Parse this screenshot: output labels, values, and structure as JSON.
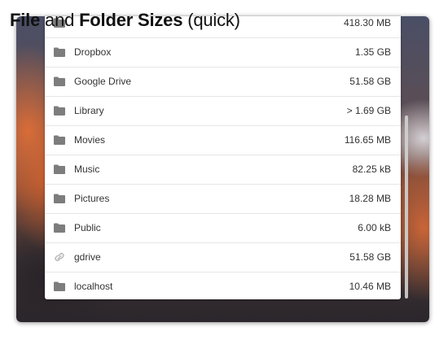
{
  "title": {
    "bold1": "File",
    "mid": "and",
    "bold2": "Folder Sizes",
    "tail": "(quick)"
  },
  "items": [
    {
      "name": "",
      "size": "418.30 MB",
      "icon": "folder-icon"
    },
    {
      "name": "Dropbox",
      "size": "1.35 GB",
      "icon": "folder-icon"
    },
    {
      "name": "Google Drive",
      "size": "51.58 GB",
      "icon": "folder-icon"
    },
    {
      "name": "Library",
      "size": "> 1.69 GB",
      "icon": "folder-icon"
    },
    {
      "name": "Movies",
      "size": "116.65 MB",
      "icon": "folder-icon"
    },
    {
      "name": "Music",
      "size": "82.25 kB",
      "icon": "folder-icon"
    },
    {
      "name": "Pictures",
      "size": "18.28 MB",
      "icon": "folder-icon"
    },
    {
      "name": "Public",
      "size": "6.00 kB",
      "icon": "folder-icon"
    },
    {
      "name": "gdrive",
      "size": "51.58 GB",
      "icon": "link-icon"
    },
    {
      "name": "localhost",
      "size": "10.46 MB",
      "icon": "folder-icon"
    }
  ],
  "colors": {
    "folder": "#7d7d7d",
    "link": "#bdbdbd",
    "text": "#333333"
  }
}
